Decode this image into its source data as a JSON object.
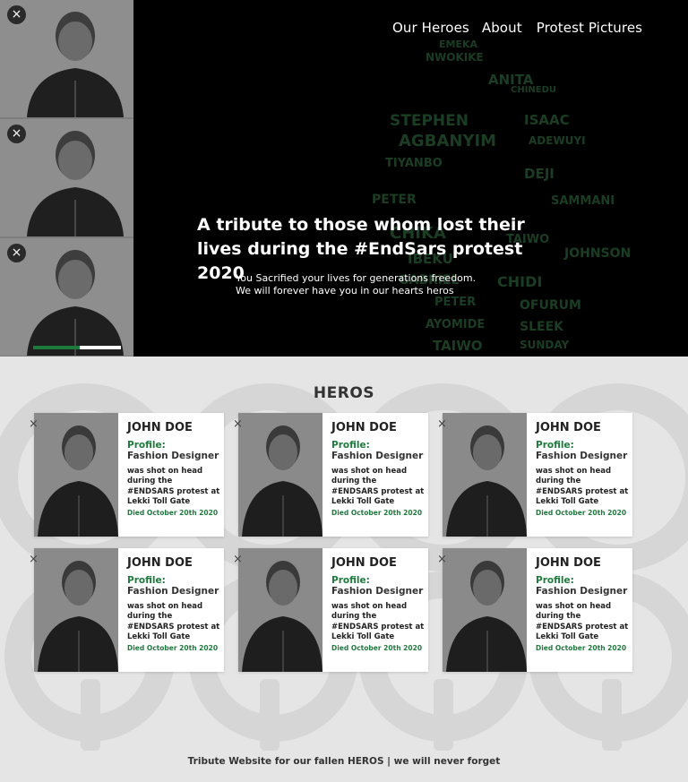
{
  "nav": {
    "items": [
      "Our Heroes",
      "About",
      "Protest Pictures"
    ]
  },
  "hero": {
    "headline": "A tribute to those whom lost their lives during the #EndSars protest 2020",
    "sub_line1": "You Sacrified your lives for generations freedom.",
    "sub_line2": "We will forever have you in our hearts heros",
    "fist_words": [
      "EMEKA",
      "NWOKIKE",
      "ANITA",
      "CHINEDU",
      "STEPHEN",
      "ISAAC",
      "AGBANYIM",
      "ADEWUYI",
      "TIYANBO",
      "DEJI",
      "PETER",
      "SAMMANI",
      "CHIKA",
      "TAIWO",
      "IBEKU",
      "JOHNSON",
      "GABRIEL",
      "CHIDI",
      "PETER",
      "OFURUM",
      "AYOMIDE",
      "SLEEK",
      "TAIWO",
      "SUNDAY"
    ],
    "slider_progress": 0.53
  },
  "sidebar": {
    "close_icon": "×",
    "thumb_count": 3
  },
  "heros_section": {
    "title": "HEROS",
    "cards": [
      {
        "name": "JOHN DOE",
        "profile_label": "Profile:",
        "profession": "Fashion Designer",
        "desc": "was shot on head during the #ENDSARS protest at Lekki Toll Gate",
        "died": "Died October 20th 2020"
      },
      {
        "name": "JOHN DOE",
        "profile_label": "Profile:",
        "profession": "Fashion Designer",
        "desc": "was shot on head during the #ENDSARS protest at Lekki Toll Gate",
        "died": "Died October 20th 2020"
      },
      {
        "name": "JOHN DOE",
        "profile_label": "Profile:",
        "profession": "Fashion Designer",
        "desc": "was shot on head during the #ENDSARS protest at Lekki Toll Gate",
        "died": "Died October 20th 2020"
      },
      {
        "name": "JOHN DOE",
        "profile_label": "Profile:",
        "profession": "Fashion Designer",
        "desc": "was shot on head during the #ENDSARS protest at Lekki Toll Gate",
        "died": "Died October 20th 2020"
      },
      {
        "name": "JOHN DOE",
        "profile_label": "Profile:",
        "profession": "Fashion Designer",
        "desc": "was shot on head during the #ENDSARS protest at Lekki Toll Gate",
        "died": "Died October 20th 2020"
      },
      {
        "name": "JOHN DOE",
        "profile_label": "Profile:",
        "profession": "Fashion Designer",
        "desc": "was shot on head during the #ENDSARS protest at Lekki Toll Gate",
        "died": "Died October 20th 2020"
      }
    ]
  },
  "footer": {
    "text": "Tribute Website for our fallen HEROS | we will never forget"
  },
  "colors": {
    "accent_green": "#1f7a3e",
    "hero_bg": "#000000",
    "section_bg": "#e5e5e5"
  },
  "icons": {
    "close": "close-icon",
    "fist": "fist-icon"
  }
}
